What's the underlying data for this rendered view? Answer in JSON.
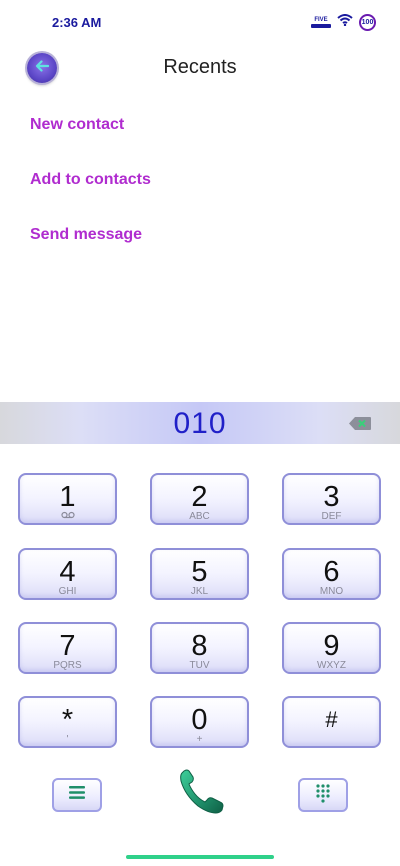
{
  "status_bar": {
    "time": "2:36 AM",
    "carrier": "FIVE",
    "battery": "100",
    "wifi_icon": "wifi-icon"
  },
  "header": {
    "title": "Recents",
    "back_icon": "arrow-left-icon"
  },
  "actions": [
    {
      "label": "New contact"
    },
    {
      "label": "Add to contacts"
    },
    {
      "label": "Send message"
    }
  ],
  "dialer": {
    "number": "010",
    "backspace_icon": "backspace-icon",
    "keys": [
      {
        "digit": "1",
        "letters": "voicemail-icon"
      },
      {
        "digit": "2",
        "letters": "ABC"
      },
      {
        "digit": "3",
        "letters": "DEF"
      },
      {
        "digit": "4",
        "letters": "GHI"
      },
      {
        "digit": "5",
        "letters": "JKL"
      },
      {
        "digit": "6",
        "letters": "MNO"
      },
      {
        "digit": "7",
        "letters": "PQRS"
      },
      {
        "digit": "8",
        "letters": "TUV"
      },
      {
        "digit": "9",
        "letters": "WXYZ"
      },
      {
        "digit": "*",
        "letters": "'"
      },
      {
        "digit": "0",
        "letters": "+"
      },
      {
        "digit": "#",
        "letters": ""
      }
    ]
  },
  "bottom_bar": {
    "menu_icon": "menu-icon",
    "call_icon": "phone-icon",
    "keypad_icon": "dialpad-icon"
  },
  "colors": {
    "accent": "#b02ccf",
    "number": "#2020c8",
    "call": "#1f8f6a",
    "home_indicator": "#2fd18a"
  }
}
